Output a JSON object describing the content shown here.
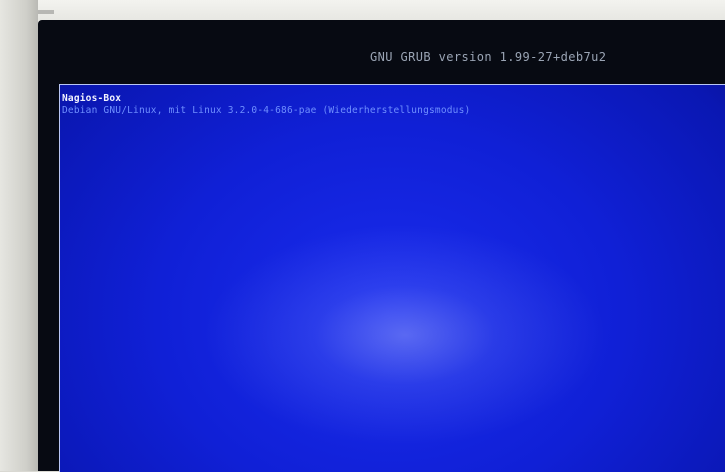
{
  "grub": {
    "header": "GNU GRUB  version 1.99-27+deb7u2",
    "entries": [
      {
        "label": "Nagios-Box",
        "selected": true
      },
      {
        "label": "Debian GNU/Linux, mit Linux 3.2.0-4-686-pae (Wiederherstellungsmodus)",
        "selected": false
      }
    ]
  },
  "colors": {
    "menu_background": "#1020d6",
    "selected_text": "#f2f4ff",
    "normal_text": "#6f8fff",
    "header_text": "#9aa4b4"
  }
}
